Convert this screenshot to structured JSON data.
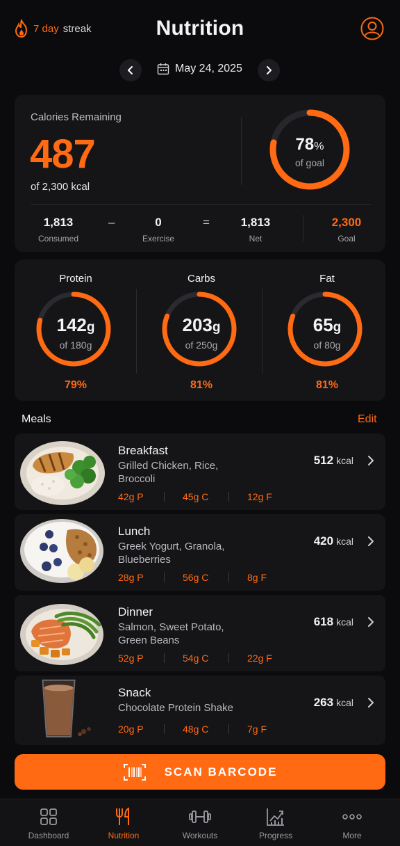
{
  "header": {
    "streak_num": "7 day",
    "streak_label": "streak",
    "title": "Nutrition"
  },
  "date": {
    "label": "May 24, 2025"
  },
  "calories": {
    "label": "Calories Remaining",
    "remaining": "487",
    "of_total": "of 2,300 kcal",
    "percent": "78",
    "percent_sign": "%",
    "percent_sub": "of goal",
    "progress": 0.78,
    "stats": [
      {
        "value": "1,813",
        "label": "Consumed"
      },
      {
        "value": "0",
        "label": "Exercise"
      },
      {
        "value": "1,813",
        "label": "Net"
      },
      {
        "value": "2,300",
        "label": "Goal"
      }
    ],
    "ops": [
      "–",
      "="
    ]
  },
  "macros": [
    {
      "name": "Protein",
      "value": "142",
      "unit": "g",
      "of": "of 180g",
      "percent": "79%",
      "progress": 0.79
    },
    {
      "name": "Carbs",
      "value": "203",
      "unit": "g",
      "of": "of 250g",
      "percent": "81%",
      "progress": 0.81
    },
    {
      "name": "Fat",
      "value": "65",
      "unit": "g",
      "of": "of 80g",
      "percent": "81%",
      "progress": 0.81
    }
  ],
  "meals_header": {
    "title": "Meals",
    "edit": "Edit"
  },
  "meals": [
    {
      "name": "Breakfast",
      "desc": "Grilled Chicken, Rice, Broccoli",
      "kcal": "512",
      "unit": "kcal",
      "p": "42g P",
      "c": "45g C",
      "f": "12g F"
    },
    {
      "name": "Lunch",
      "desc": "Greek Yogurt, Granola, Blueberries",
      "kcal": "420",
      "unit": "kcal",
      "p": "28g P",
      "c": "56g C",
      "f": "8g F"
    },
    {
      "name": "Dinner",
      "desc": "Salmon, Sweet Potato, Green Beans",
      "kcal": "618",
      "unit": "kcal",
      "p": "52g P",
      "c": "54g C",
      "f": "22g F"
    },
    {
      "name": "Snack",
      "desc": "Chocolate Protein Shake",
      "kcal": "263",
      "unit": "kcal",
      "p": "20g P",
      "c": "48g C",
      "f": "7g F"
    }
  ],
  "scan_label": "SCAN BARCODE",
  "tabs": [
    {
      "label": "Dashboard",
      "icon": "grid-icon"
    },
    {
      "label": "Nutrition",
      "icon": "fork-knife-icon"
    },
    {
      "label": "Workouts",
      "icon": "dumbbell-icon"
    },
    {
      "label": "Progress",
      "icon": "chart-line-icon"
    },
    {
      "label": "More",
      "icon": "more-dots-icon"
    }
  ],
  "colors": {
    "accent": "#ff6a13",
    "background": "#0b0b0d",
    "card": "#151518"
  }
}
